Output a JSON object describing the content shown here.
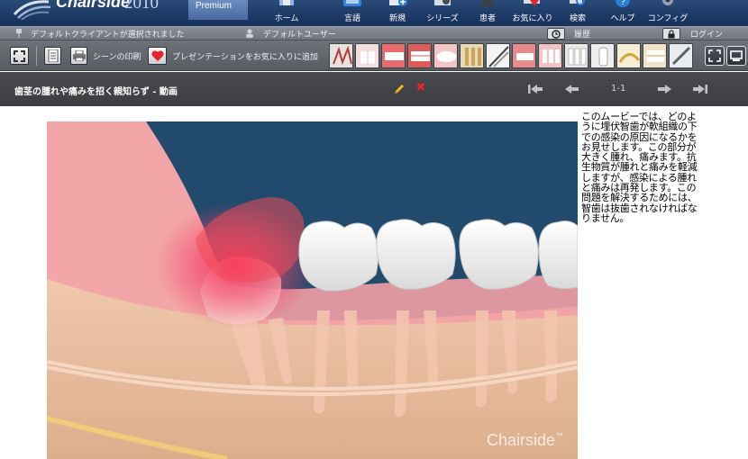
{
  "app": {
    "brand": "Chairside",
    "year": "2010",
    "edition": "Premium"
  },
  "nav": [
    {
      "label": "ホーム",
      "icon": "home-icon"
    },
    {
      "label": "言語",
      "icon": "language-icon"
    },
    {
      "label": "新規",
      "icon": "new-icon"
    },
    {
      "label": "シリーズ",
      "icon": "series-icon"
    },
    {
      "label": "患者",
      "icon": "patient-icon"
    },
    {
      "label": "お気に入り",
      "icon": "favorites-icon"
    },
    {
      "label": "検索",
      "icon": "search-icon"
    },
    {
      "label": "ヘルプ",
      "icon": "help-icon"
    },
    {
      "label": "コンフィグ",
      "icon": "config-icon"
    }
  ],
  "infobar": {
    "client_status": "デフォルトクライアントが選択されました",
    "user": "デフォルトユーザー",
    "history": "履歴",
    "login": "ログイン"
  },
  "toolbar": {
    "print_scene": "シーンの印刷",
    "add_favorite": "プレゼンテーションをお気に入りに追加"
  },
  "title": {
    "text": "歯茎の腫れや痛みを招く親知らず - 動画"
  },
  "pager": {
    "count": "1-1"
  },
  "video": {
    "watermark": "Chairside"
  },
  "description": "このムービーでは、どのように埋伏智歯が軟組織の下での感染の原因になるかをお見せします。この部分が大きく腫れ、痛みます。抗生物質が腫れと痛みを軽減しますが、感染による腫れと痛みは再発します。この問題を解決するためには、智歯は抜歯されなければなりません。",
  "colors": {
    "topbar": "#1d3a66",
    "titlebar": "#3f4144",
    "accent_red": "#e4252b",
    "edit_yellow": "#f2c21b"
  }
}
